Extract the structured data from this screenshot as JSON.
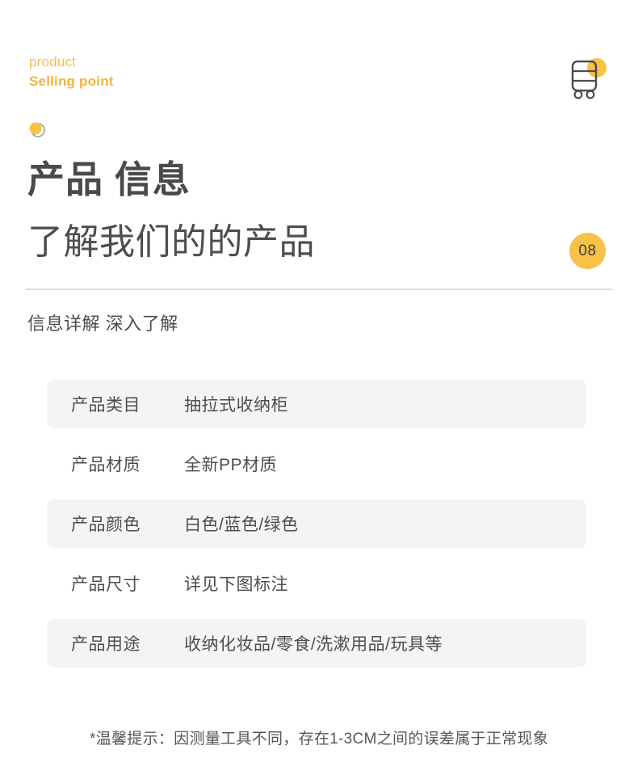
{
  "eyebrow": {
    "line1": "product",
    "line2": "Selling point",
    "accent_color": "#F5B441"
  },
  "cart_icon": {
    "name": "storage-cart-icon",
    "accent_color": "#F8C247",
    "stroke_color": "#4d4d4d"
  },
  "dot_marker": {
    "name": "dot-marker",
    "fill_color": "#F8C247",
    "ring_color": "#9a9a9a"
  },
  "heading": {
    "main": "产品 信息",
    "sub": "了解我们的的产品",
    "color": "#4a4a4a"
  },
  "badge": {
    "number": "08",
    "background": "#F8C247",
    "text_color": "#3f3f3f"
  },
  "section": {
    "label": "信息详解 深入了解"
  },
  "spec_table": {
    "rows": [
      {
        "key": "产品类目",
        "value": "抽拉式收纳柜",
        "shaded": true
      },
      {
        "key": "产品材质",
        "value": "全新PP材质",
        "shaded": false
      },
      {
        "key": "产品颜色",
        "value": "白色/蓝色/绿色",
        "shaded": true
      },
      {
        "key": "产品尺寸",
        "value": "详见下图标注",
        "shaded": false
      },
      {
        "key": "产品用途",
        "value": "收纳化妆品/零食/洗漱用品/玩具等",
        "shaded": true
      }
    ],
    "row_shade_color": "#f4f4f4"
  },
  "footer": {
    "note": "*温馨提示：因测量工具不同，存在1-3CM之间的误差属于正常现象"
  }
}
